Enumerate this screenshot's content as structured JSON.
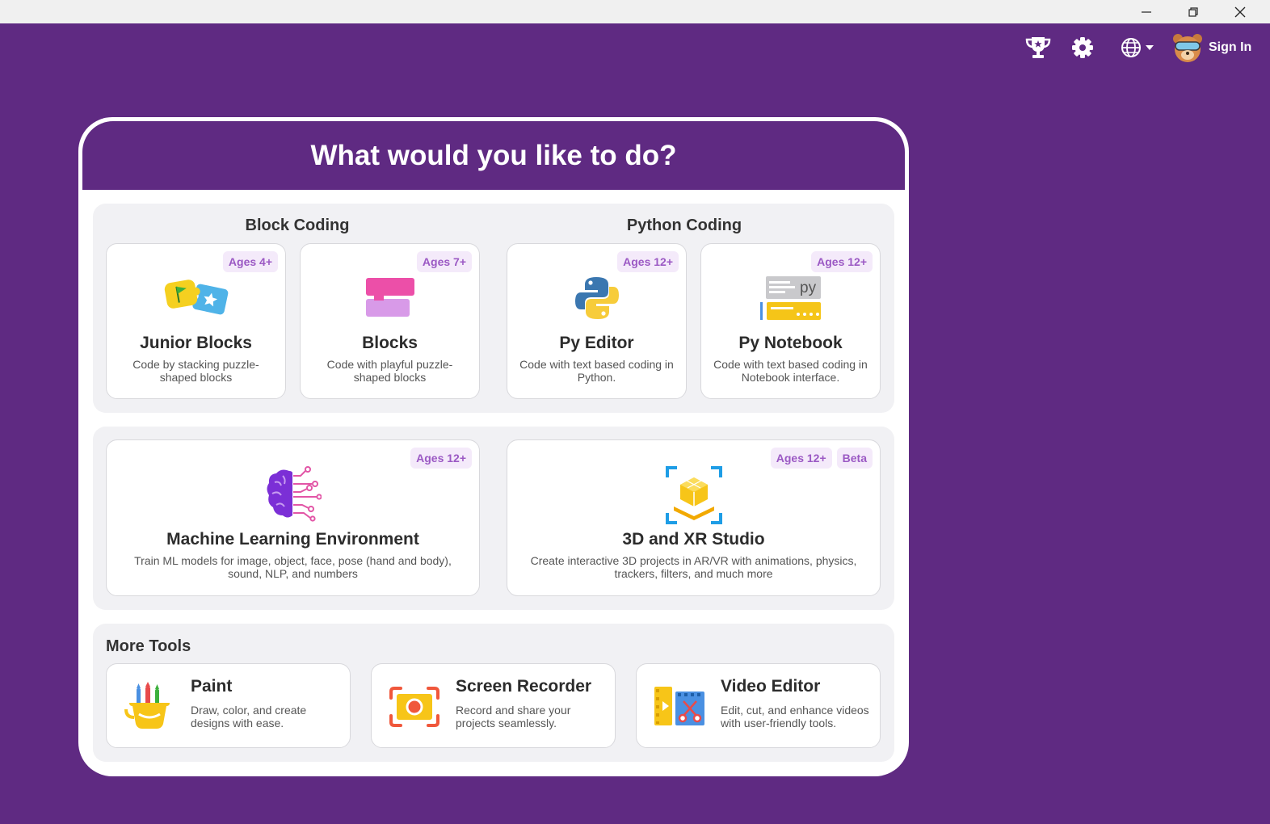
{
  "window": {
    "minimize_icon": "minimize-icon",
    "restore_icon": "restore-icon",
    "close_icon": "close-icon"
  },
  "nav": {
    "trophy_icon": "trophy-icon",
    "settings_icon": "gear-icon",
    "language_icon": "globe-icon",
    "avatar_icon": "bear-avatar-icon",
    "sign_in_label": "Sign In"
  },
  "main": {
    "title": "What would you like to do?",
    "block_coding": {
      "title": "Block Coding",
      "tiles": [
        {
          "name": "Junior Blocks",
          "badge": "Ages 4+",
          "desc": "Code by stacking puzzle-shaped blocks",
          "icon": "junior-blocks-icon"
        },
        {
          "name": "Blocks",
          "badge": "Ages 7+",
          "desc": "Code with playful puzzle-shaped blocks",
          "icon": "blocks-icon"
        }
      ]
    },
    "python_coding": {
      "title": "Python Coding",
      "tiles": [
        {
          "name": "Py Editor",
          "badge": "Ages 12+",
          "desc": "Code with text based coding in Python.",
          "icon": "python-icon"
        },
        {
          "name": "Py Notebook",
          "badge": "Ages 12+",
          "desc": "Code with text based coding in Notebook interface.",
          "icon": "notebook-icon"
        }
      ]
    },
    "advanced": [
      {
        "name": "Machine Learning Environment",
        "badges": [
          "Ages 12+"
        ],
        "desc": "Train ML models for image, object, face, pose (hand and body), sound, NLP, and numbers",
        "icon": "brain-icon"
      },
      {
        "name": "3D and XR Studio",
        "badges": [
          "Ages 12+",
          "Beta"
        ],
        "desc": "Create interactive 3D projects in AR/VR with animations, physics, trackers, filters, and much more",
        "icon": "3d-cube-icon"
      }
    ],
    "more_tools": {
      "title": "More Tools",
      "tools": [
        {
          "name": "Paint",
          "desc": "Draw, color, and create designs with ease.",
          "icon": "paint-bucket-icon"
        },
        {
          "name": "Screen Recorder",
          "desc": "Record and share your projects seamlessly.",
          "icon": "screen-recorder-icon"
        },
        {
          "name": "Video Editor",
          "desc": "Edit, cut, and enhance videos with user-friendly tools.",
          "icon": "video-editor-icon"
        }
      ]
    }
  },
  "colors": {
    "brand_purple": "#5f2a82",
    "badge_bg": "#f4eafa",
    "badge_text": "#9b59c4",
    "section_bg": "#f1f1f4"
  }
}
